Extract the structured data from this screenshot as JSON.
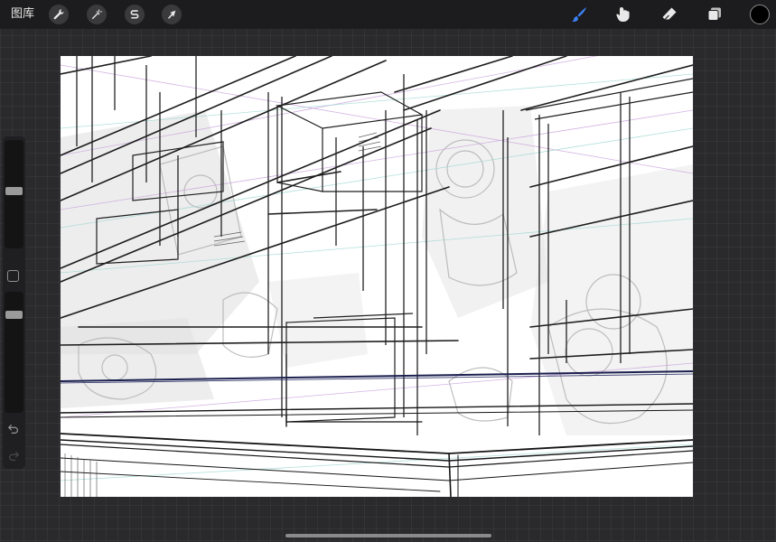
{
  "topbar": {
    "gallery_label": "图库",
    "left_tools": [
      {
        "name": "actions",
        "icon": "wrench-icon"
      },
      {
        "name": "adjustments",
        "icon": "magic-wand-icon"
      },
      {
        "name": "selection",
        "icon": "selection-s-icon"
      },
      {
        "name": "transform",
        "icon": "arrow-cursor-icon"
      }
    ],
    "right_tools": [
      {
        "name": "brush",
        "icon": "brush-icon",
        "active": true
      },
      {
        "name": "smudge",
        "icon": "smudge-icon",
        "active": false
      },
      {
        "name": "eraser",
        "icon": "eraser-icon",
        "active": false
      },
      {
        "name": "layers",
        "icon": "layers-icon",
        "active": false
      }
    ],
    "active_color": "#000000",
    "accent_color": "#3b82f6"
  },
  "sidebar": {
    "brush_size_level": 0.55,
    "opacity_level": 0.85,
    "modify_icon": "square-icon",
    "undo_icon": "undo-icon",
    "redo_icon": "redo-icon"
  },
  "canvas": {
    "background": "#ffffff",
    "content": "perspective-sketch"
  }
}
